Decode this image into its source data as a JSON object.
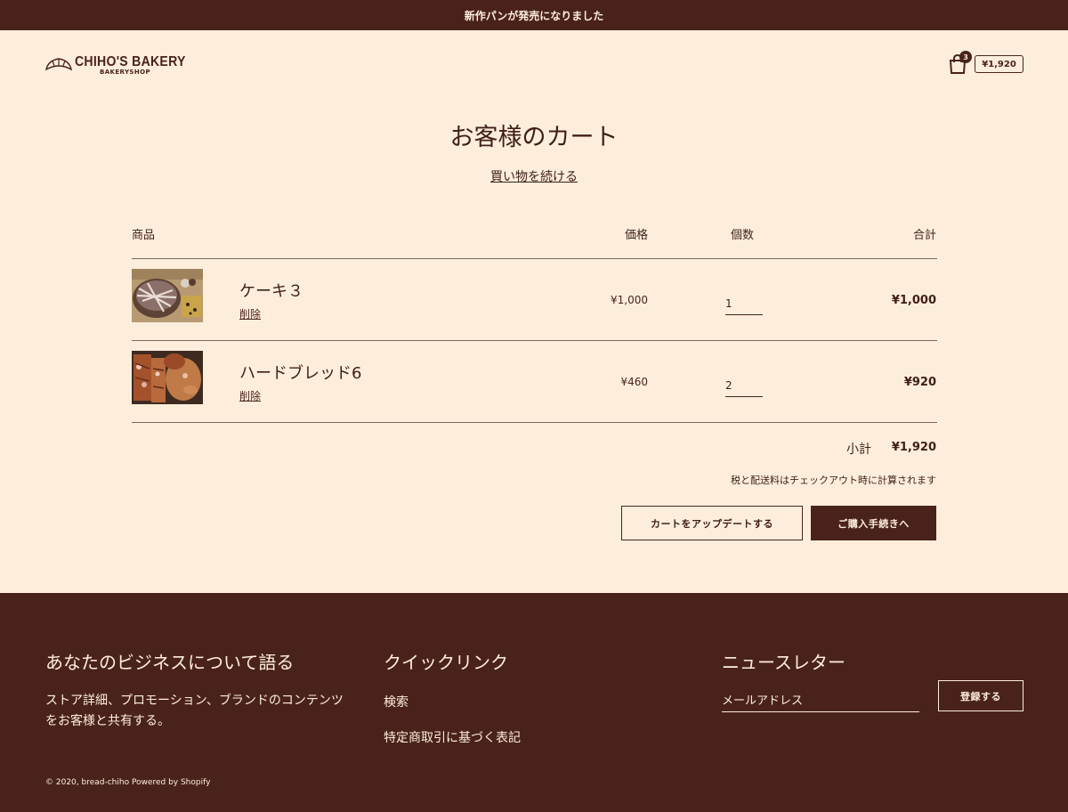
{
  "announcement": "新作パンが発売になりました",
  "header": {
    "logo_main": "CHIHO'S BAKERY",
    "logo_sub": "BAKERYSHOP",
    "cart_count": "3",
    "cart_total": "¥1,920"
  },
  "cart": {
    "title": "お客様のカート",
    "continue_label": "買い物を続ける",
    "columns": {
      "product": "商品",
      "price": "価格",
      "quantity": "個数",
      "total": "合計"
    },
    "items": [
      {
        "name": "ケーキ３",
        "remove": "削除",
        "price": "¥1,000",
        "quantity": "1",
        "total": "¥1,000"
      },
      {
        "name": "ハードブレッド6",
        "remove": "削除",
        "price": "¥460",
        "quantity": "2",
        "total": "¥920"
      }
    ],
    "subtotal_label": "小計",
    "subtotal_value": "¥1,920",
    "tax_note": "税と配送料はチェックアウト時に計算されます",
    "update_button": "カートをアップデートする",
    "checkout_button": "ご購入手続きへ"
  },
  "footer": {
    "about_title": "あなたのビジネスについて語る",
    "about_text": "ストア詳細、プロモーション、ブランドのコンテンツをお客様と共有する。",
    "quicklinks_title": "クイックリンク",
    "links": [
      "検索",
      "特定商取引に基づく表記"
    ],
    "newsletter_title": "ニュースレター",
    "email_placeholder": "メールアドレス",
    "subscribe_button": "登録する",
    "copyright": "© 2020, bread-chiho Powered by Shopify"
  },
  "colors": {
    "brand_dark": "#4a221c",
    "background": "#fdeedb"
  }
}
